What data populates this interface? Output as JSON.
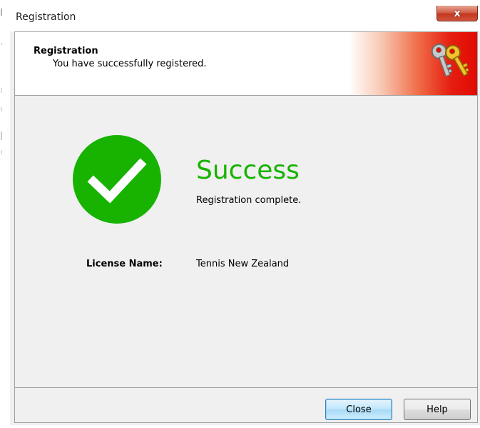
{
  "window": {
    "title": "Registration",
    "close_glyph": "x"
  },
  "banner": {
    "heading": "Registration",
    "subheading": "You have successfully registered.",
    "icon": "keys-icon"
  },
  "status": {
    "icon": "check-circle-icon",
    "title": "Success",
    "message": "Registration complete.",
    "accent_color": "#17b300"
  },
  "license": {
    "label": "License Name:",
    "value": "Tennis New Zealand"
  },
  "footer": {
    "close_label": "Close",
    "help_label": "Help"
  }
}
